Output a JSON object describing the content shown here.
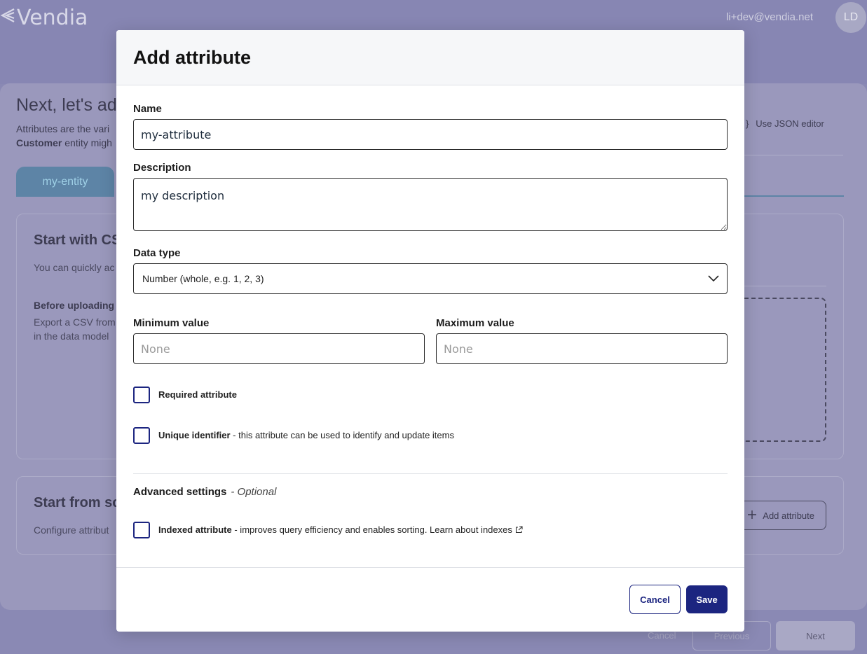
{
  "app": {
    "logo_text": "Vendia",
    "user_email": "li+dev@vendia.net",
    "avatar_initials": "LD"
  },
  "background": {
    "title": "Next, let's add",
    "subtitle_line1": "Attributes are the vari",
    "subtitle_bold": "Customer",
    "subtitle_line2": "entity migh",
    "json_editor_icon": "{ }",
    "json_editor_label": "Use JSON editor",
    "entity_tab": "my-entity",
    "csv_title": "Start with CS",
    "csv_desc": "You can quickly ac",
    "before_upload_title": "Before uploading",
    "before_upload_line1": "Export a CSV from",
    "before_upload_line2": "in the data model",
    "scratch_title": "Start from sc",
    "scratch_desc": "Configure attribut",
    "add_attribute_label": "Add attribute",
    "footer_cancel": "Cancel",
    "footer_previous": "Previous",
    "footer_next": "Next"
  },
  "modal": {
    "title": "Add attribute",
    "name_label": "Name",
    "name_value": "my-attribute",
    "description_label": "Description",
    "description_value": "my description",
    "data_type_label": "Data type",
    "data_type_value": "Number (whole, e.g. 1, 2, 3)",
    "min_label": "Minimum value",
    "min_placeholder": "None",
    "max_label": "Maximum value",
    "max_placeholder": "None",
    "required_label": "Required attribute",
    "unique_label_bold": "Unique identifier",
    "unique_label_rest": " - this attribute can be used to identify and update items",
    "advanced_title": "Advanced settings",
    "advanced_optional": "- Optional",
    "indexed_label_bold": "Indexed attribute",
    "indexed_label_rest": " - improves query efficiency and enables sorting. ",
    "indexed_link": "Learn about indexes",
    "cancel_label": "Cancel",
    "save_label": "Save"
  },
  "colors": {
    "primary": "#1c2580",
    "overlay": "#8a89b4"
  }
}
